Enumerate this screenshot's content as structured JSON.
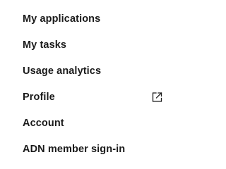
{
  "menu": {
    "items": [
      {
        "label": "My applications"
      },
      {
        "label": "My tasks"
      },
      {
        "label": "Usage analytics"
      },
      {
        "label": "Profile",
        "icon": "external-link-icon"
      },
      {
        "label": "Account"
      },
      {
        "label": "ADN member sign-in"
      }
    ]
  },
  "colors": {
    "text": "#1a1a1a",
    "background": "#ffffff"
  }
}
